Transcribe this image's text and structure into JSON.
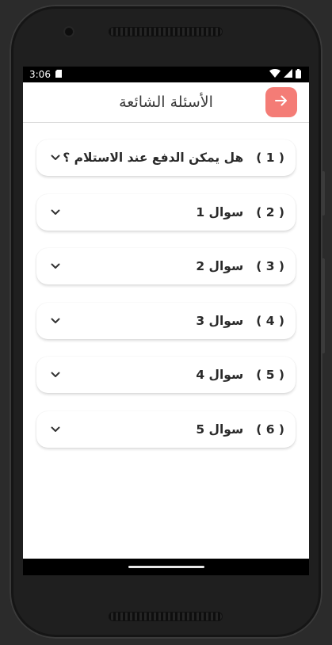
{
  "status_bar": {
    "time": "3:06",
    "icons": [
      "sd-card-icon",
      "wifi-icon",
      "signal-icon",
      "battery-icon"
    ]
  },
  "app_bar": {
    "title": "الأسئلة الشائعة",
    "back_icon": "arrow-right-icon",
    "accent_color": "#f47c76"
  },
  "faq": {
    "items": [
      {
        "number": "( 1 )",
        "question": "هل يمكن الدفع عند الاستلام ؟"
      },
      {
        "number": "( 2 )",
        "question": "سوال 1"
      },
      {
        "number": "( 3 )",
        "question": "سوال 2"
      },
      {
        "number": "( 4 )",
        "question": "سوال 3"
      },
      {
        "number": "( 5 )",
        "question": "سوال 4"
      },
      {
        "number": "( 6 )",
        "question": "سوال 5"
      }
    ],
    "expand_icon": "chevron-down-icon"
  }
}
